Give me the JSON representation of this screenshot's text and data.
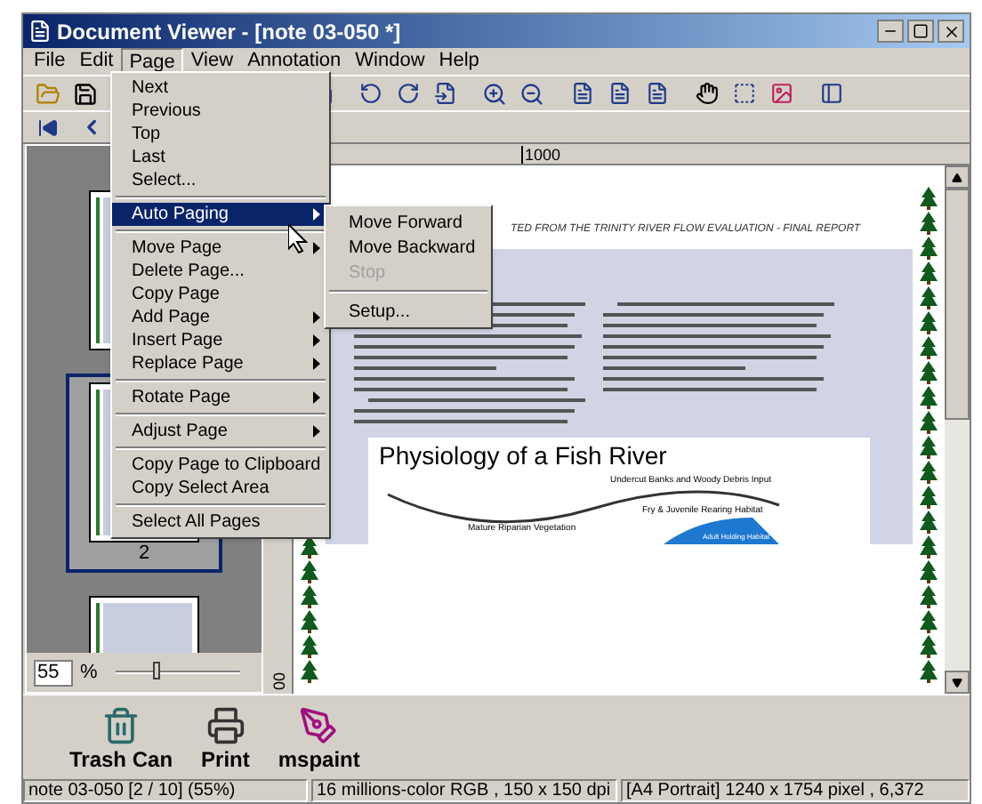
{
  "window": {
    "title": "Document Viewer - [note 03-050 *]"
  },
  "menu_bar": [
    {
      "label": "File",
      "selected": false
    },
    {
      "label": "Edit",
      "selected": false
    },
    {
      "label": "Page",
      "selected": true
    },
    {
      "label": "View",
      "selected": false
    },
    {
      "label": "Annotation",
      "selected": false
    },
    {
      "label": "Window",
      "selected": false
    },
    {
      "label": "Help",
      "selected": false
    }
  ],
  "page_menu": [
    {
      "kind": "item",
      "label": "Next",
      "selected": false,
      "submenu": false
    },
    {
      "kind": "item",
      "label": "Previous",
      "selected": false,
      "submenu": false
    },
    {
      "kind": "item",
      "label": "Top",
      "selected": false,
      "submenu": false
    },
    {
      "kind": "item",
      "label": "Last",
      "selected": false,
      "submenu": false
    },
    {
      "kind": "item",
      "label": "Select...",
      "selected": false,
      "submenu": false
    },
    {
      "kind": "separator"
    },
    {
      "kind": "item",
      "label": "Auto Paging",
      "selected": true,
      "submenu": true
    },
    {
      "kind": "separator"
    },
    {
      "kind": "item",
      "label": "Move Page",
      "selected": false,
      "submenu": true
    },
    {
      "kind": "item",
      "label": "Delete Page...",
      "selected": false,
      "submenu": false
    },
    {
      "kind": "item",
      "label": "Copy Page",
      "selected": false,
      "submenu": false
    },
    {
      "kind": "item",
      "label": "Add Page",
      "selected": false,
      "submenu": true
    },
    {
      "kind": "item",
      "label": "Insert Page",
      "selected": false,
      "submenu": true
    },
    {
      "kind": "item",
      "label": "Replace Page",
      "selected": false,
      "submenu": true
    },
    {
      "kind": "separator"
    },
    {
      "kind": "item",
      "label": "Rotate Page",
      "selected": false,
      "submenu": true
    },
    {
      "kind": "separator"
    },
    {
      "kind": "item",
      "label": "Adjust Page",
      "selected": false,
      "submenu": true
    },
    {
      "kind": "separator"
    },
    {
      "kind": "item",
      "label": "Copy Page to Clipboard",
      "selected": false,
      "submenu": false
    },
    {
      "kind": "item",
      "label": "Copy Select Area",
      "selected": false,
      "submenu": false
    },
    {
      "kind": "separator"
    },
    {
      "kind": "item",
      "label": "Select All Pages",
      "selected": false,
      "submenu": false
    }
  ],
  "auto_paging_menu": [
    {
      "kind": "item",
      "label": "Move Forward",
      "disabled": false
    },
    {
      "kind": "item",
      "label": "Move Backward",
      "disabled": false
    },
    {
      "kind": "item",
      "label": "Stop",
      "disabled": true
    },
    {
      "kind": "separator"
    },
    {
      "kind": "item",
      "label": "Setup...",
      "disabled": false
    }
  ],
  "thumbnails": [
    {
      "selected": false
    },
    {
      "label": "2",
      "selected": true
    },
    {
      "selected": false
    }
  ],
  "zoom": {
    "value": "55",
    "unit": "%",
    "level": 0.32
  },
  "rulers": {
    "horizontal_label": "1000",
    "vertical_label": "00"
  },
  "document": {
    "header": "TED FROM THE TRINITY RIVER FLOW EVALUATION - FINAL REPORT",
    "figure_title": "Physiology of a Fish River",
    "figure_labels": [
      "Undercut Banks and Woody Debris Input",
      "Fry & Juvenile Rearing Habitat",
      "Mature Riparian Vegetation",
      "Adult Holding Habitat"
    ]
  },
  "shortcuts": [
    {
      "kind": "trash",
      "label": "Trash Can"
    },
    {
      "kind": "printer",
      "label": "Print"
    },
    {
      "kind": "paint",
      "label": "mspaint"
    }
  ],
  "status_bar": [
    "note 03-050 [2 / 10] (55%)",
    "16 millions-color RGB ,  150 x 150 dpi",
    "[A4 Portrait]  1240 x 1754 pixel , 6,372"
  ]
}
